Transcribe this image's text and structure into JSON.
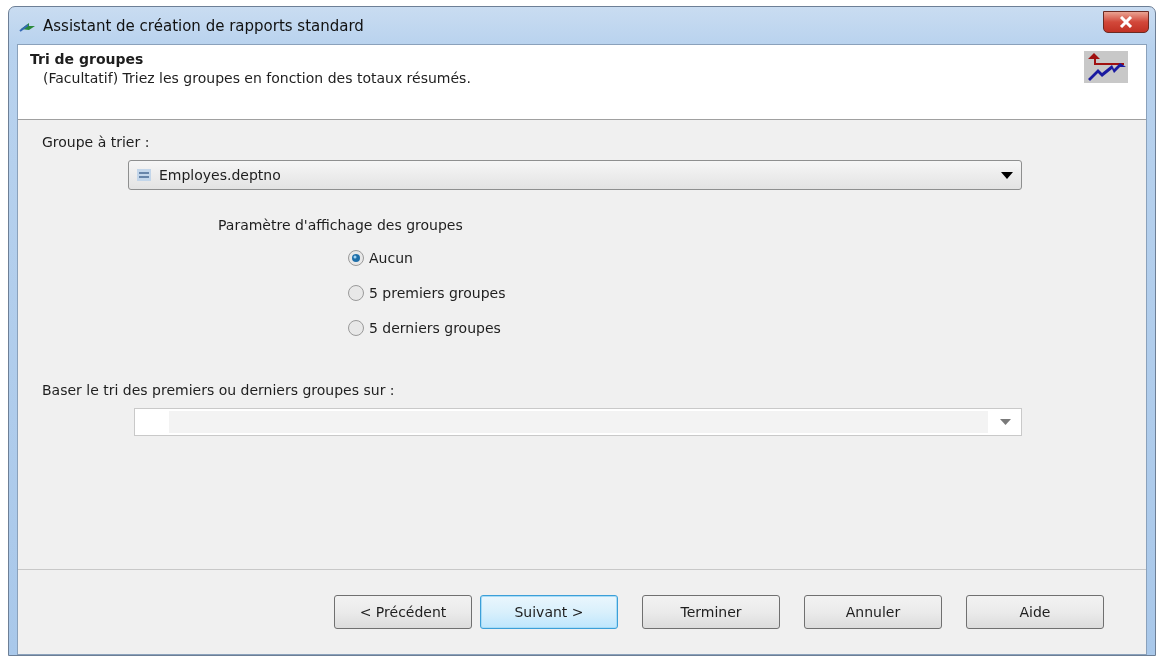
{
  "window": {
    "title": "Assistant de création de rapports standard"
  },
  "header": {
    "title": "Tri de groupes",
    "subtitle": "(Facultatif) Triez les groupes en fonction des totaux résumés."
  },
  "group_field": {
    "label": "Groupe à trier :",
    "value": "Employes.deptno"
  },
  "display_options": {
    "label": "Paramètre d'affichage des groupes",
    "options": [
      {
        "label": "Aucun",
        "selected": true
      },
      {
        "label": "5 premiers groupes",
        "selected": false
      },
      {
        "label": "5 derniers groupes",
        "selected": false
      }
    ]
  },
  "sort_basis": {
    "label": "Baser le tri des premiers ou derniers groupes sur :",
    "disabled": true
  },
  "buttons": [
    {
      "label": "< Précédent",
      "default": false
    },
    {
      "label": "Suivant >",
      "default": true
    },
    {
      "label": "Terminer",
      "default": false
    },
    {
      "label": "Annuler",
      "default": false
    },
    {
      "label": "Aide",
      "default": false
    }
  ]
}
